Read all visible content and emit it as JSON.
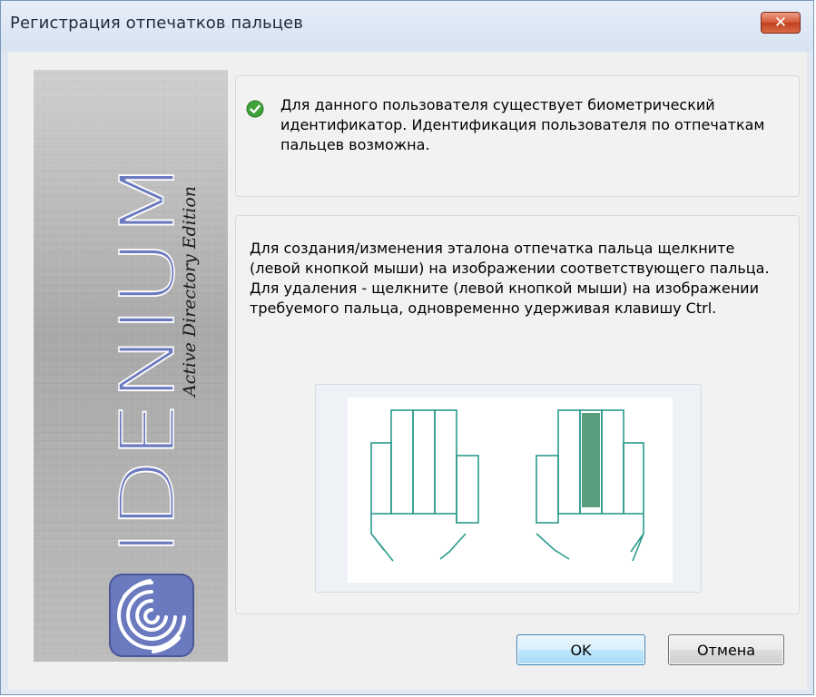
{
  "window": {
    "title": "Регистрация отпечатков пальцев",
    "close_symbol": "✕",
    "close_icon": "close-icon"
  },
  "banner": {
    "brand": "IDENIUM",
    "edition": "Active Directory Edition",
    "logo_icon": "fingerprint-swirl-icon"
  },
  "status": {
    "icon": "check-circle-icon",
    "text": "Для данного пользователя существует биометрический идентификатор. Идентификация пользователя по отпечаткам пальцев возможна."
  },
  "instructions": {
    "text": "Для создания/изменения эталона отпечатка пальца щелкните (левой кнопкой мыши)  на изображении соответствующего пальца. Для удаления - щелкните (левой кнопкой мыши) на изображении требуемого пальца, одновременно удерживая клавишу Ctrl."
  },
  "hands": {
    "left_hand_fingers": [
      "little",
      "ring",
      "middle",
      "index",
      "thumb"
    ],
    "right_hand_fingers": [
      "thumb",
      "index",
      "middle",
      "ring",
      "little"
    ],
    "enrolled": [
      "right-index"
    ],
    "outline_color": "#2a9a8c",
    "enrolled_color": "#5a9e7e"
  },
  "buttons": {
    "ok_label": "OK",
    "cancel_label": "Отмена"
  },
  "colors": {
    "accent_blue": "#6b79bf",
    "status_green": "#3fa33a"
  }
}
